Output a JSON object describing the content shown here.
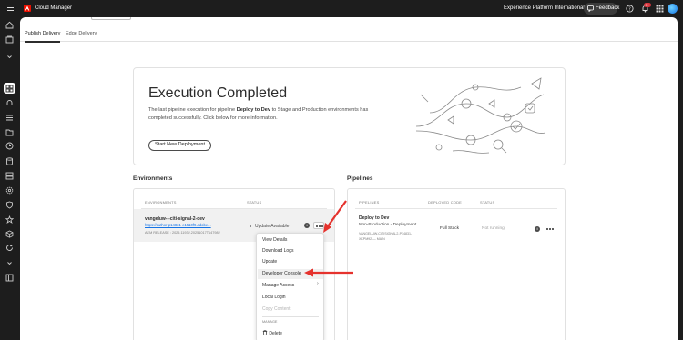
{
  "header": {
    "app_name": "Cloud Manager",
    "org_name": "Experience Platform International",
    "feedback_label": "Feedback",
    "notification_count": "9+"
  },
  "tabs": [
    {
      "label": "Publish Delivery",
      "selected": true
    },
    {
      "label": "Edge Delivery",
      "selected": false
    }
  ],
  "hero": {
    "title": "Execution Completed",
    "text_before": "The last pipeline execution for pipeline ",
    "pipeline_name": "Deploy to Dev",
    "text_after": " to Stage and Production environments has completed successfully. Click below for more information.",
    "button_label": "Start New Deployment"
  },
  "environments": {
    "title": "Environments",
    "col_env": "ENVIRONMENTS",
    "col_status": "STATUS",
    "row": {
      "name": "vangeluw---citi-signal-2-dev",
      "link": "https://author-p14831-e1510f9.adobe...",
      "release": "AEM RELEASE : 2025.11932.20251017T147982",
      "status": "Update Available"
    }
  },
  "menu": {
    "items": [
      "View Details",
      "Download Logs",
      "Update",
      "Developer Console",
      "Manage Access",
      "Local Login",
      "Copy Content"
    ],
    "manage_header": "MANAGE",
    "delete_label": "Delete"
  },
  "pipelines": {
    "title": "Pipelines",
    "col_pipelines": "PIPELINES",
    "col_code": "DEPLOYED CODE",
    "col_status": "STATUS",
    "row": {
      "name": "Deploy to Dev",
      "subtitle": "Non-Production - Deployment",
      "meta1": "VANGELUW-CITISIGNAL2-P14831-",
      "meta2": "XKPM92 — MAIN",
      "code": "Full Stack",
      "status": "Not running"
    }
  },
  "colors": {
    "annotation_arrow": "#e5322d",
    "link": "#1473e6",
    "chrome": "#1d1d1d"
  }
}
